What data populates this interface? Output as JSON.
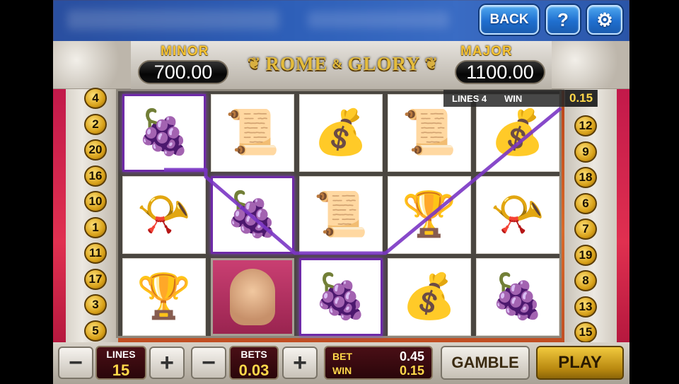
{
  "top": {
    "back_label": "BACK",
    "help_label": "?",
    "settings_icon": "gear-icon",
    "settings_glyph": "⚙"
  },
  "jackpots": {
    "minor_label": "MINOR",
    "minor_value": "700.00",
    "major_label": "MAJOR",
    "major_value": "1100.00"
  },
  "logo": {
    "left_word": "ROME",
    "amp": "&",
    "right_word": "GLORY"
  },
  "paylines_left": [
    "4",
    "2",
    "20",
    "16",
    "10",
    "1",
    "11",
    "17",
    "3",
    "5"
  ],
  "paylines_right": [
    "12",
    "9",
    "18",
    "6",
    "7",
    "19",
    "8",
    "13",
    "15"
  ],
  "win_info": {
    "lines_label": "LINES 4",
    "win_label": "WIN",
    "win_value": "0.15"
  },
  "reels": [
    [
      "grapes",
      "horn",
      "chalice"
    ],
    [
      "scroll",
      "grapes",
      "portrait"
    ],
    [
      "coin-pot",
      "scroll",
      "grapes"
    ],
    [
      "scroll",
      "chalice",
      "coin-pot"
    ],
    [
      "coin-pot",
      "horn",
      "grapes"
    ]
  ],
  "winning_cells": [
    "0-0",
    "1-1",
    "2-2"
  ],
  "controls": {
    "minus_label": "−",
    "plus_label": "+",
    "lines_title": "LINES",
    "lines_value": "15",
    "bets_title": "BETS",
    "bets_value": "0.03",
    "bet_label": "BET",
    "bet_value": "0.45",
    "win_label": "WIN",
    "win_value": "0.15",
    "gamble_label": "GAMBLE",
    "play_label": "PLAY"
  },
  "colors": {
    "accent_purple": "#6e2aa8",
    "gold": "#f6c436",
    "button_blue": "#1f6fcf"
  }
}
